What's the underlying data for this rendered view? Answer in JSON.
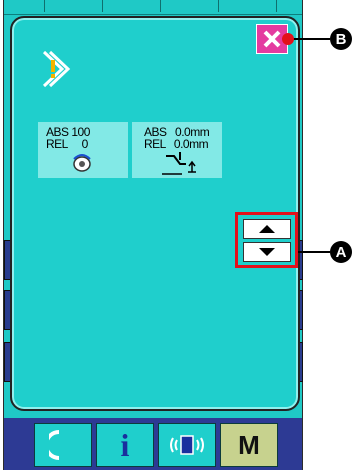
{
  "cards": [
    {
      "line1": "ABS 100",
      "line2": "REL     0",
      "icon": "bobbin-winder-icon"
    },
    {
      "line1": "ABS   0.0mm",
      "line2": "REL   0.0mm",
      "icon": "presser-foot-icon"
    }
  ],
  "callouts": {
    "a": "A",
    "b": "B"
  },
  "bottom": {
    "m_label": "M",
    "info_label": "i"
  },
  "colors": {
    "screen": "#1fcfcc",
    "close": "#e43ba0",
    "highlight": "#e3101a",
    "bar": "#2d3a94"
  }
}
